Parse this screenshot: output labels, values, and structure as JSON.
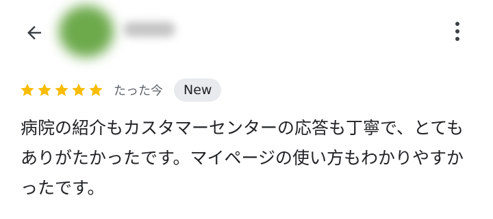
{
  "header": {
    "back_icon": "arrow-back-icon",
    "more_icon": "more-vert-icon"
  },
  "review": {
    "rating": 5,
    "rating_max": 5,
    "star_color": "#fbbc04",
    "timestamp": "たった今",
    "badge": "New",
    "text": "病院の紹介もカスタマーセンターの応答も丁寧で、とてもありがたかったです。マイページの使い方もわかりやすかったです。"
  }
}
